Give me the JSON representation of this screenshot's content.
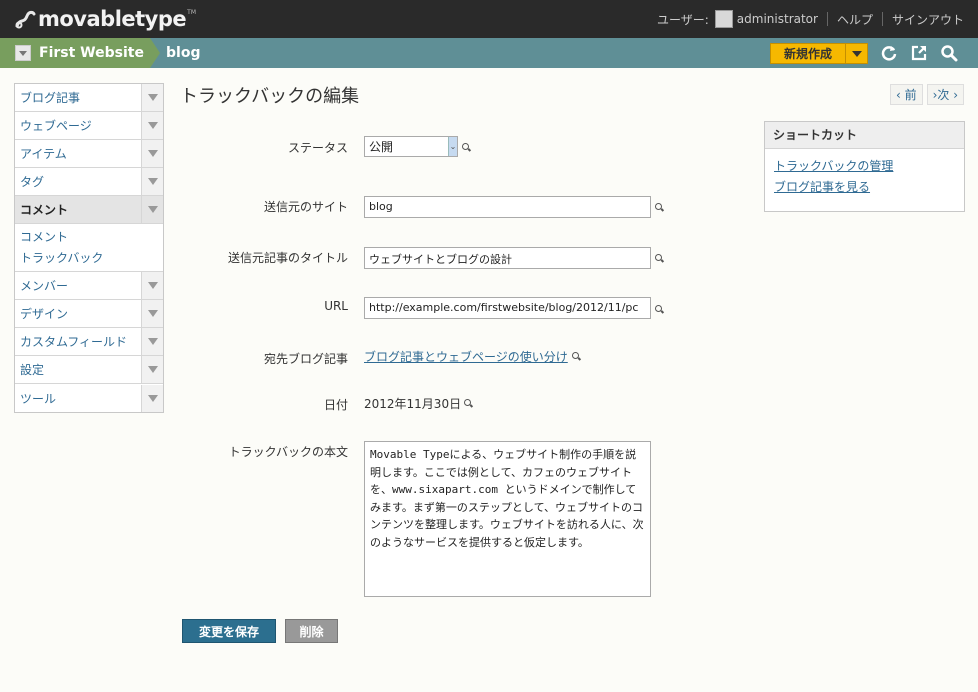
{
  "topbar": {
    "logo_text": "movabletype",
    "logo_tm": "TM",
    "user_label": "ユーザー:",
    "username": "administrator",
    "help": "ヘルプ",
    "signout": "サインアウト"
  },
  "sitebar": {
    "site_name": "First Website",
    "blog_name": "blog",
    "new_button": "新規作成",
    "icons": [
      "refresh-icon",
      "external-link-icon",
      "search-icon"
    ]
  },
  "menu": {
    "items": [
      {
        "label": "ブログ記事"
      },
      {
        "label": "ウェブページ"
      },
      {
        "label": "アイテム"
      },
      {
        "label": "タグ"
      },
      {
        "label": "コメント",
        "active": true,
        "sub": [
          "コメント",
          "トラックバック"
        ]
      },
      {
        "label": "メンバー"
      },
      {
        "label": "デザイン"
      },
      {
        "label": "カスタムフィールド"
      },
      {
        "label": "設定"
      },
      {
        "label": "ツール"
      }
    ]
  },
  "page": {
    "title": "トラックバックの編集",
    "prev": "‹ 前",
    "next": "›次 ›"
  },
  "form": {
    "status_label": "ステータス",
    "status_value": "公開",
    "source_site_label": "送信元のサイト",
    "source_site_value": "blog",
    "source_title_label": "送信元記事のタイトル",
    "source_title_value": "ウェブサイトとブログの設計",
    "url_label": "URL",
    "url_value": "http://example.com/firstwebsite/blog/2012/11/pc",
    "target_label": "宛先ブログ記事",
    "target_value": "ブログ記事とウェブページの使い分け",
    "date_label": "日付",
    "date_value": "2012年11月30日",
    "body_label": "トラックバックの本文",
    "body_value": "Movable Typeによる、ウェブサイト制作の手順を説明します。ここでは例として、カフェのウェブサイトを、www.sixapart.com というドメインで制作してみます。まず第一のステップとして、ウェブサイトのコンテンツを整理します。ウェブサイトを訪れる人に、次のようなサービスを提供すると仮定します。"
  },
  "actions": {
    "save": "変更を保存",
    "delete": "削除"
  },
  "shortcut": {
    "title": "ショートカット",
    "links": [
      "トラックバックの管理",
      "ブログ記事を見る"
    ]
  }
}
